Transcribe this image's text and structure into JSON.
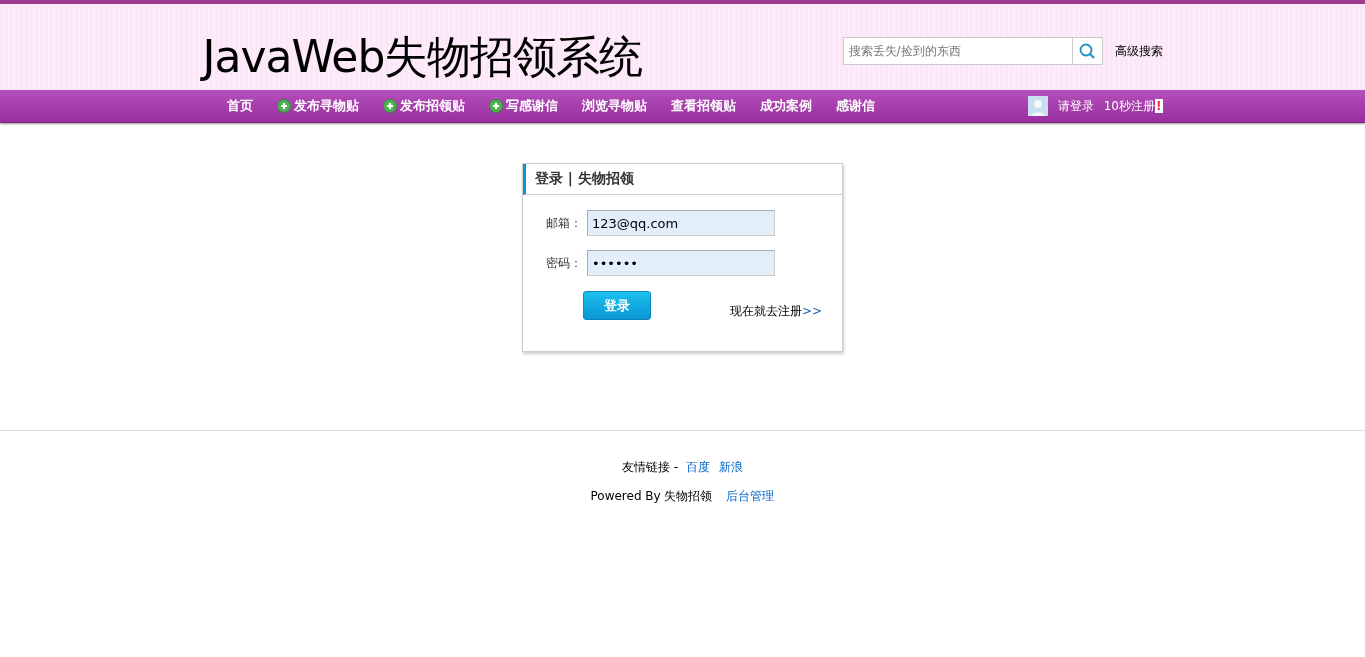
{
  "header": {
    "logo": "JavaWeb失物招领系统",
    "search": {
      "placeholder": "搜索丢失/捡到的东西"
    },
    "advanced_search": "高级搜索"
  },
  "nav": {
    "items": [
      {
        "label": "首页",
        "kind": "plain"
      },
      {
        "label": "发布寻物贴",
        "kind": "add"
      },
      {
        "label": "发布招领贴",
        "kind": "add"
      },
      {
        "label": "写感谢信",
        "kind": "add"
      },
      {
        "label": "浏览寻物贴",
        "kind": "plain"
      },
      {
        "label": "查看招领贴",
        "kind": "plain"
      },
      {
        "label": "成功案例",
        "kind": "plain"
      },
      {
        "label": "感谢信",
        "kind": "plain"
      }
    ],
    "login": "请登录",
    "register": "10秒注册",
    "register_mark": "!"
  },
  "login_box": {
    "title": "登录 | 失物招领",
    "fields": [
      {
        "label": "邮箱：",
        "value": "123@qq.com"
      },
      {
        "label": "密码：",
        "value": "••••••"
      }
    ],
    "button": "登录",
    "register_link": "现在就去注册",
    "register_arrows": ">>"
  },
  "footer": {
    "links_label": "友情链接 -",
    "links": [
      "百度",
      "新浪"
    ],
    "powered": "Powered By 失物招领",
    "admin": "后台管理"
  }
}
